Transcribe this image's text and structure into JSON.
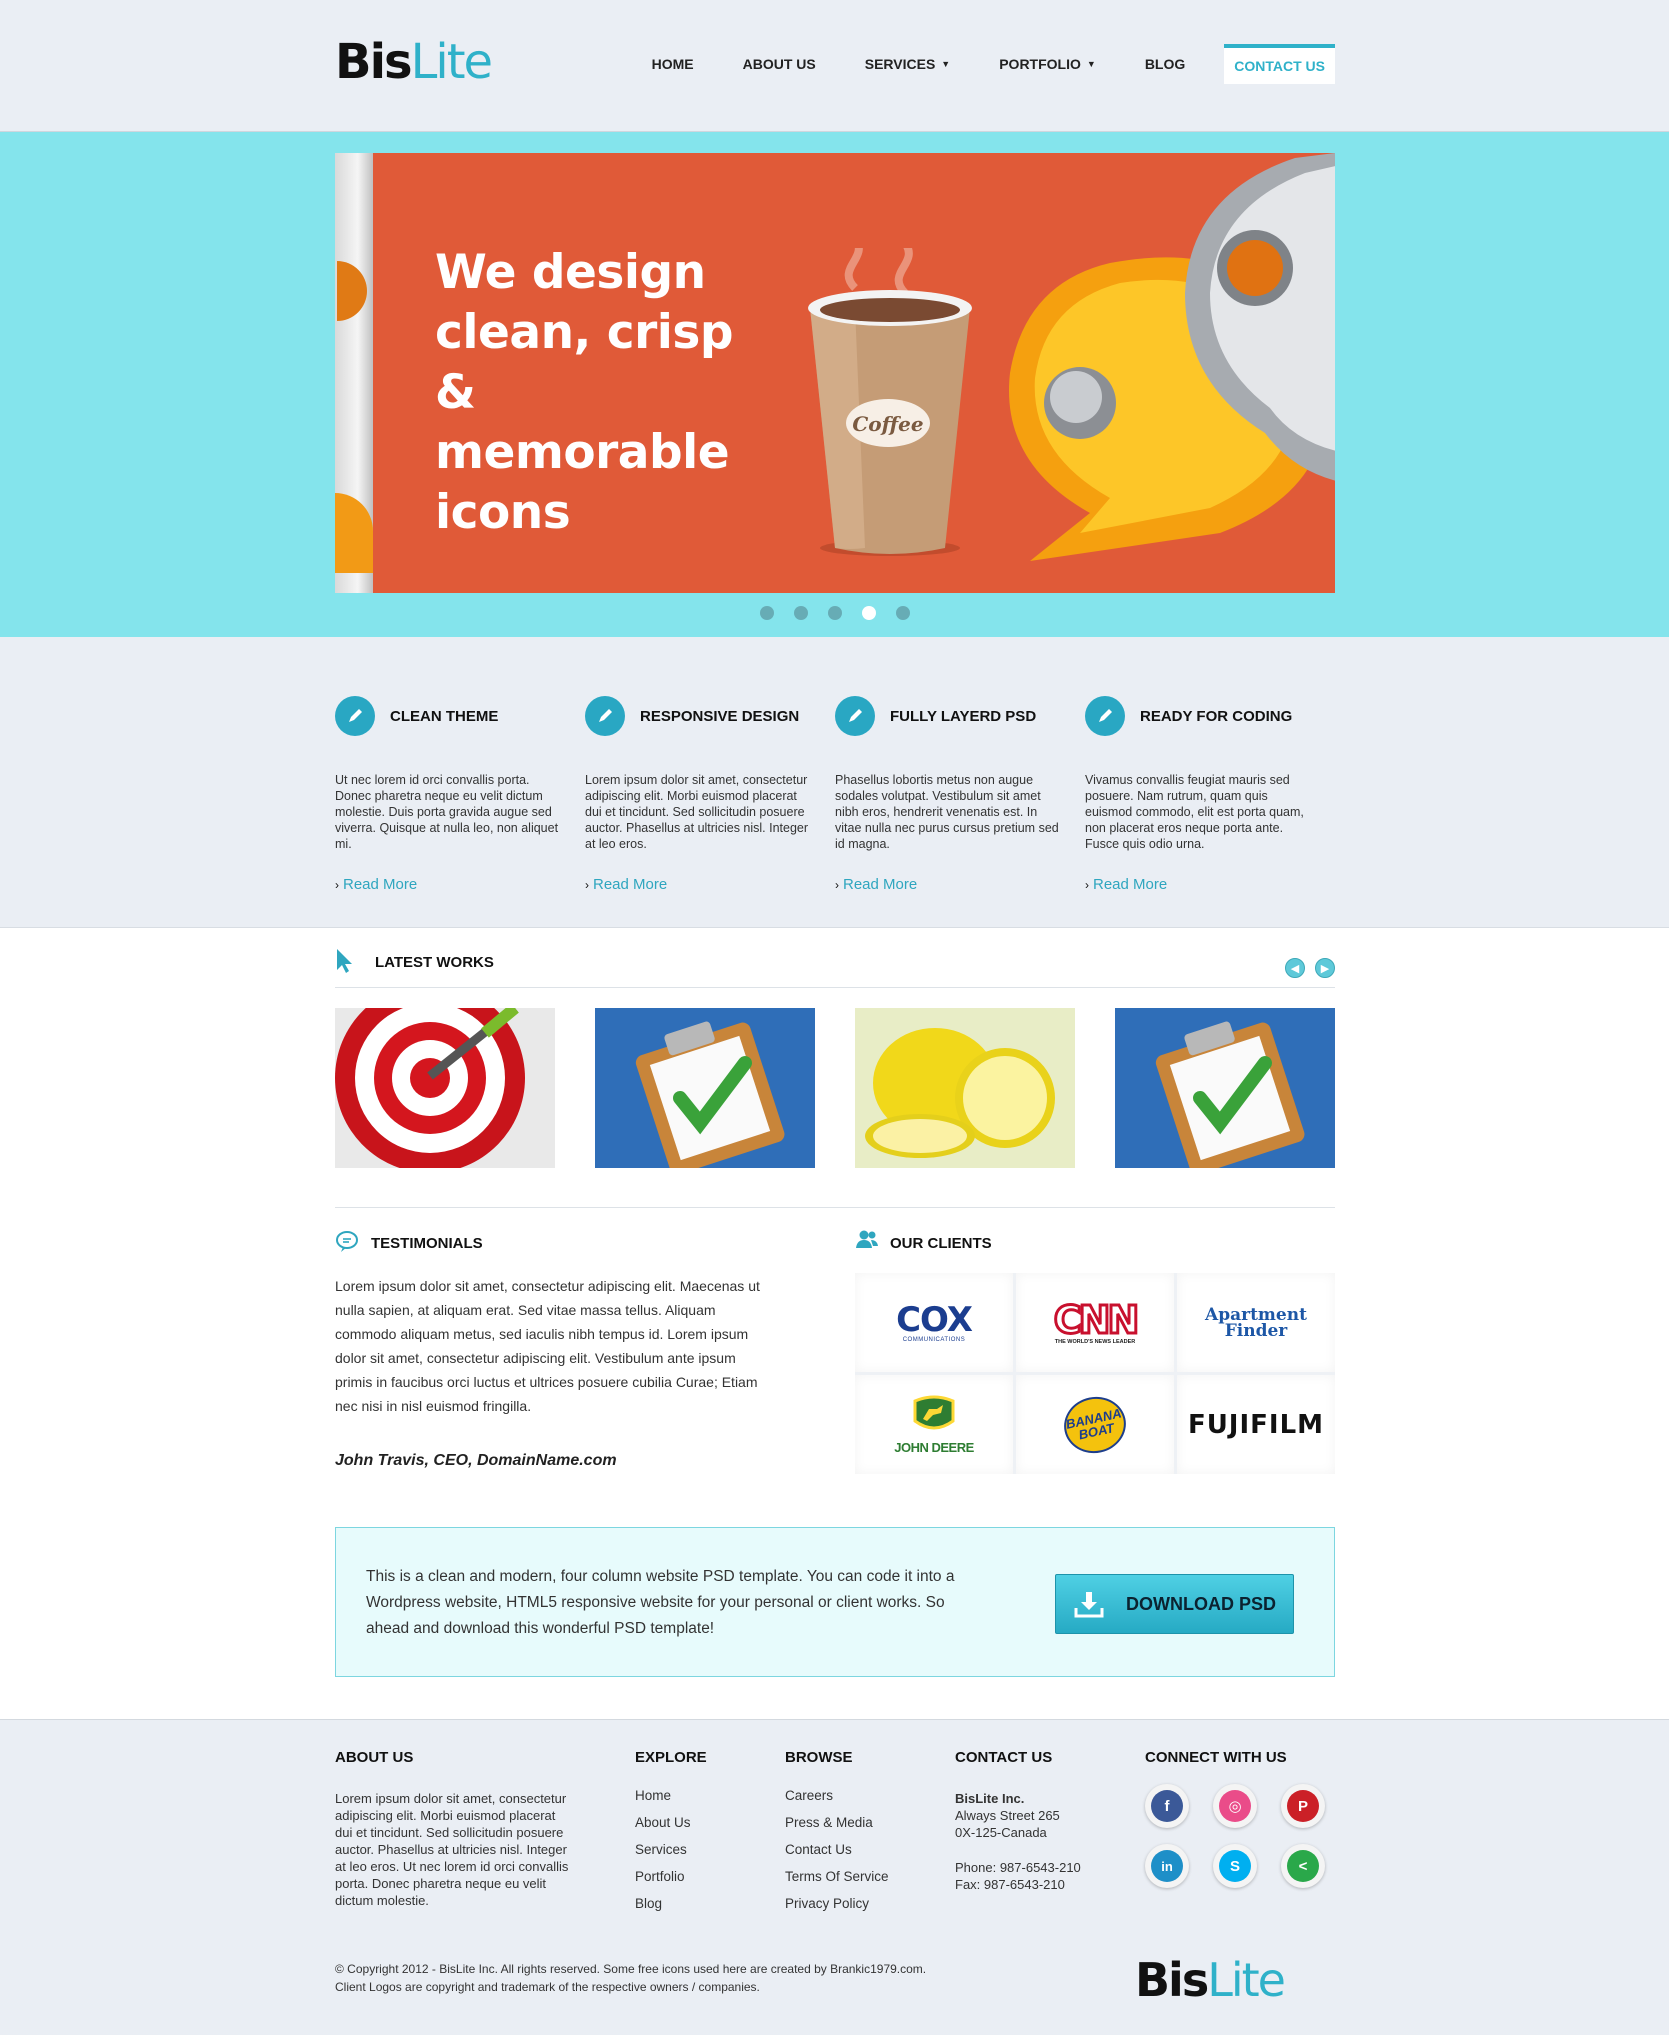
{
  "brand": {
    "name_bold": "Bis",
    "name_light": "Lite",
    "accent_color": "#2fb1c9"
  },
  "nav": {
    "items": [
      {
        "label": "HOME"
      },
      {
        "label": "ABOUT US"
      },
      {
        "label": "SERVICES",
        "has_dropdown": true
      },
      {
        "label": "PORTFOLIO",
        "has_dropdown": true
      },
      {
        "label": "BLOG"
      },
      {
        "label": "CONTACT US",
        "active": true
      }
    ]
  },
  "hero": {
    "title": "We design clean, crisp & memorable icons",
    "cup_label": "Coffee",
    "slide_count": 5,
    "active_slide": 4,
    "band_color": "#84e4ec",
    "slide_color": "#e05a38"
  },
  "features": [
    {
      "icon": "pencil-icon",
      "title": "CLEAN THEME",
      "text": "Ut nec lorem id orci convallis porta. Donec pharetra neque eu velit dictum molestie. Duis porta gravida augue sed viverra. Quisque at nulla leo, non aliquet mi.",
      "link": "Read More"
    },
    {
      "icon": "pencil-icon",
      "title": "RESPONSIVE DESIGN",
      "text": "Lorem ipsum dolor sit amet, consectetur adipiscing elit. Morbi euismod placerat dui et tincidunt. Sed sollicitudin posuere auctor. Phasellus at ultricies nisl. Integer at leo eros.",
      "link": "Read More"
    },
    {
      "icon": "pencil-icon",
      "title": "FULLY LAYERD PSD",
      "text": "Phasellus lobortis metus non augue sodales volutpat. Vestibulum sit amet nibh eros, hendrerit venenatis est. In vitae nulla nec purus cursus pretium sed id magna.",
      "link": "Read More"
    },
    {
      "icon": "pencil-icon",
      "title": "READY FOR CODING",
      "text": "Vivamus convallis feugiat mauris sed posuere. Nam rutrum, quam quis euismod commodo, elit est porta quam, non placerat eros neque porta ante. Fusce quis odio urna.",
      "link": "Read More"
    }
  ],
  "latest_works": {
    "title": "LATEST WORKS",
    "items": [
      "target-icon",
      "clipboard-check-icon",
      "lemon-icon",
      "clipboard-check-icon"
    ]
  },
  "testimonials": {
    "title": "TESTIMONIALS",
    "text": "Lorem ipsum dolor sit amet, consectetur adipiscing elit. Maecenas ut nulla sapien, at aliquam erat. Sed vitae massa tellus. Aliquam commodo aliquam metus, sed iaculis nibh tempus id. Lorem ipsum dolor sit amet, consectetur adipiscing elit. Vestibulum ante ipsum primis in faucibus orci luctus et ultrices posuere cubilia Curae; Etiam nec nisi in nisl euismod fringilla.",
    "author": "John Travis, CEO, DomainName.com"
  },
  "clients": {
    "title": "OUR CLIENTS",
    "logos": [
      {
        "main": "COX",
        "sub": "COMMUNICATIONS"
      },
      {
        "main": "CNN",
        "sub": "THE WORLD'S NEWS LEADER"
      },
      {
        "main": "Apartment",
        "sub": "Finder"
      },
      {
        "main": "JOHN DEERE",
        "sub": ""
      },
      {
        "main": "BANANA",
        "sub": "BOAT"
      },
      {
        "main": "FUJIFILM",
        "sub": ""
      }
    ]
  },
  "cta": {
    "text": "This is a clean and modern, four column website PSD template. You can code it into a Wordpress website, HTML5 responsive website for your personal or client works. So ahead and download this wonderful PSD template!",
    "button": "DOWNLOAD PSD"
  },
  "footer": {
    "about": {
      "title": "ABOUT US",
      "text": "Lorem ipsum dolor sit amet, consectetur adipiscing elit. Morbi euismod placerat dui et tincidunt. Sed sollicitudin posuere auctor. Phasellus at ultricies nisl. Integer at leo eros. Ut nec lorem id orci convallis porta. Donec pharetra neque eu velit dictum molestie."
    },
    "explore": {
      "title": "EXPLORE",
      "links": [
        "Home",
        "About Us",
        "Services",
        "Portfolio",
        "Blog"
      ]
    },
    "browse": {
      "title": "BROWSE",
      "links": [
        "Careers",
        "Press & Media",
        "Contact Us",
        "Terms Of Service",
        "Privacy Policy"
      ]
    },
    "contact": {
      "title": "CONTACT US",
      "company": "BisLite Inc.",
      "street": "Always Street 265",
      "city": "0X-125-Canada",
      "phone": "Phone: 987-6543-210",
      "fax": "Fax: 987-6543-210"
    },
    "connect": {
      "title": "CONNECT WITH US",
      "networks": [
        {
          "name": "facebook-icon",
          "glyph": "f",
          "color": "#3b5998"
        },
        {
          "name": "dribbble-icon",
          "glyph": "◎",
          "color": "#ea4c89"
        },
        {
          "name": "pinterest-icon",
          "glyph": "P",
          "color": "#cb2027"
        },
        {
          "name": "linkedin-icon",
          "glyph": "in",
          "color": "#1e8fc8"
        },
        {
          "name": "skype-icon",
          "glyph": "S",
          "color": "#00aff0"
        },
        {
          "name": "share-icon",
          "glyph": "<",
          "color": "#2aa84a"
        }
      ]
    },
    "copyright_line1": "© Copyright 2012 - BisLite Inc. All rights reserved. Some free icons used here are created by Brankic1979.com.",
    "copyright_line2": "Client Logos are copyright and trademark of the respective owners / companies."
  }
}
